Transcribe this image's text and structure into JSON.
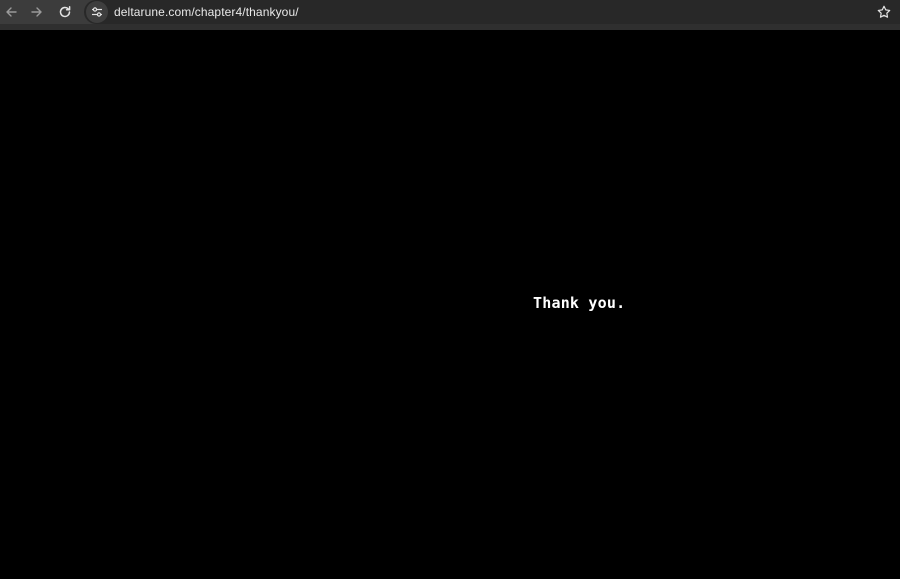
{
  "browser": {
    "url": "deltarune.com/chapter4/thankyou/",
    "back_icon": "arrow-left-icon",
    "forward_icon": "arrow-right-icon",
    "reload_icon": "reload-icon",
    "site_info_icon": "tune-icon",
    "bookmark_icon": "star-icon"
  },
  "page": {
    "message": "Thank you.",
    "background_color": "#000000",
    "text_color": "#ffffff"
  }
}
